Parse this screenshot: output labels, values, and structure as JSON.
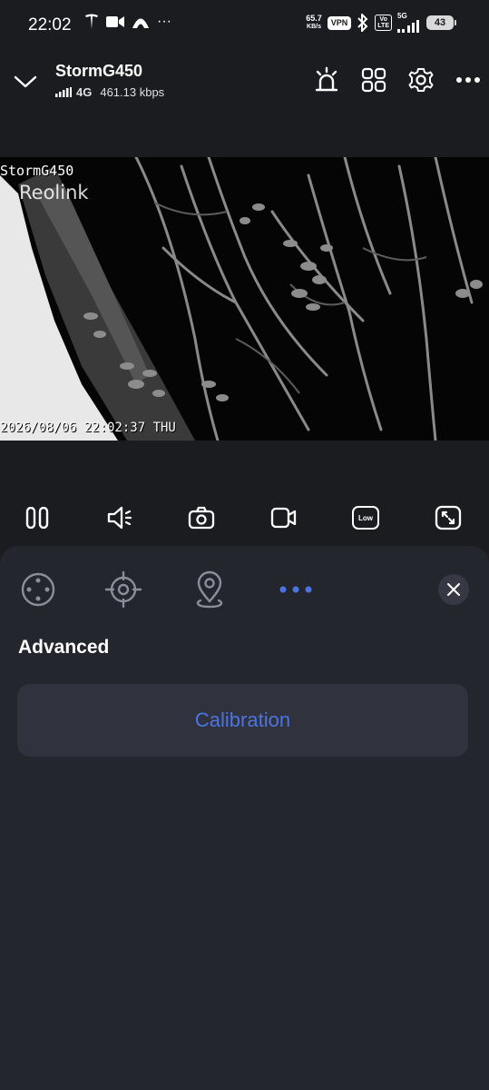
{
  "status_bar": {
    "time": "22:02",
    "net_speed_value": "65.7",
    "net_speed_unit": "KB/s",
    "vpn_label": "VPN",
    "volte_label": "Vo\nLTE",
    "signal_type": "5G",
    "battery_level": "43"
  },
  "header": {
    "camera_name": "StormG450",
    "network_type": "4G",
    "bitrate": "461.13 kbps"
  },
  "video": {
    "osd_camera_name": "StormG450",
    "osd_brand": "Reolink",
    "osd_timestamp": "2026/08/06 22:02:37 THU"
  },
  "controls": {
    "quality_label": "Low"
  },
  "panel": {
    "section_title": "Advanced",
    "calibration_label": "Calibration"
  },
  "colors": {
    "accent": "#4c74e0",
    "panel_bg": "#24262e",
    "button_bg": "#30333d",
    "app_bg": "#1b1c20"
  }
}
